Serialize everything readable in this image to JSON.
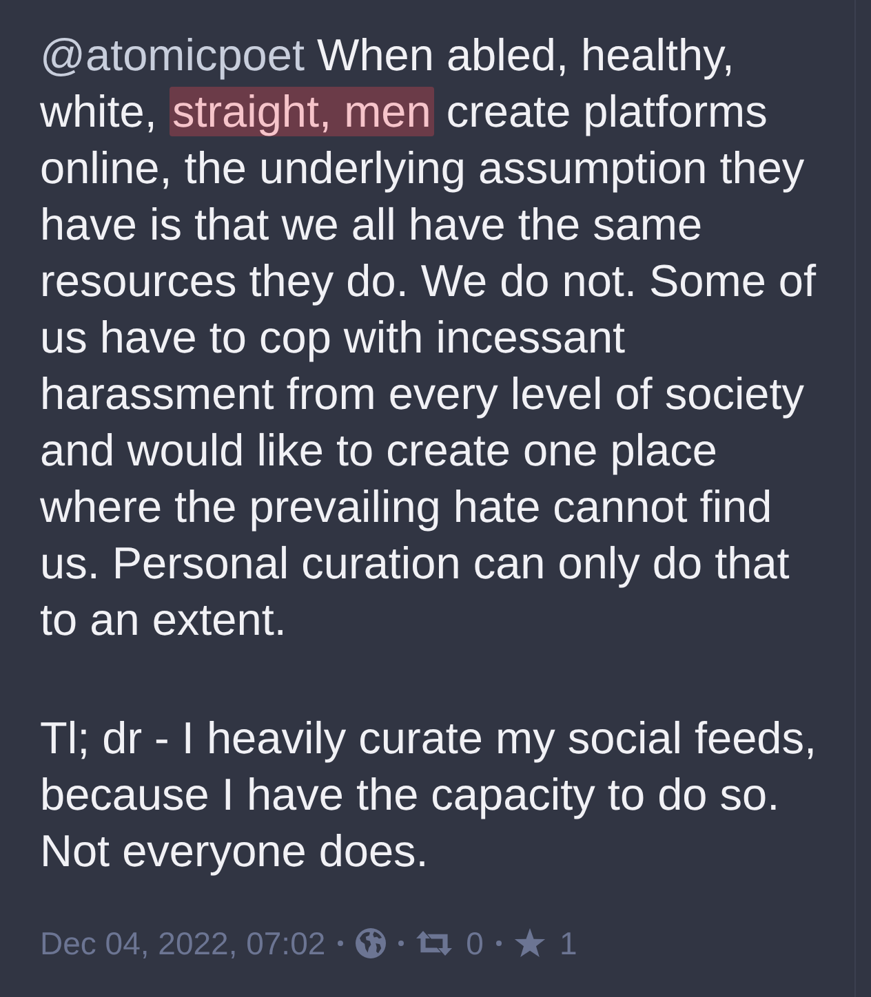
{
  "post": {
    "paragraphs": [
      {
        "segments": [
          {
            "kind": "mention",
            "text": "@atomicpoet"
          },
          {
            "kind": "text",
            "text": " When abled, healthy, white, "
          },
          {
            "kind": "highlight",
            "text": "straight, men"
          },
          {
            "kind": "text",
            "text": " create platforms online, the underlying assumption they have is that we all have the same resources they do. We do not. Some of us have to cop with incessant harassment from every level of society and would like to create one place where the prevailing hate cannot find us. Personal curation can only do that to an extent."
          }
        ]
      },
      {
        "segments": [
          {
            "kind": "text",
            "text": "Tl; dr - I heavily curate my social feeds, because I have the capacity to do so. Not everyone does."
          }
        ]
      }
    ],
    "meta": {
      "timestamp": "Dec 04, 2022, 07:02",
      "boosts": "0",
      "favourites": "1"
    }
  }
}
